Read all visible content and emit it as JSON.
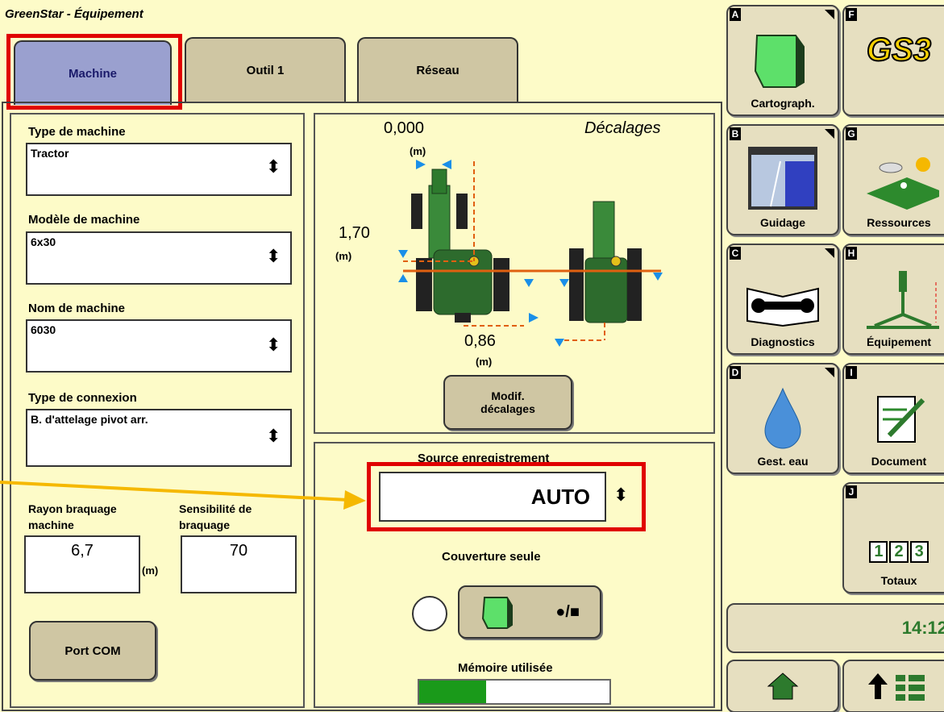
{
  "window_title": "GreenStar - Équipement",
  "tabs": [
    {
      "label": "Machine"
    },
    {
      "label": "Outil 1"
    },
    {
      "label": "Réseau"
    }
  ],
  "machine": {
    "type_label": "Type de machine",
    "type_value": "Tractor",
    "model_label": "Modèle de machine",
    "model_value": "6x30",
    "name_label": "Nom de machine",
    "name_value": "6030",
    "connection_label": "Type de connexion",
    "connection_value": "B. d'attelage pivot arr.",
    "turn_radius_label_1": "Rayon braquage",
    "turn_radius_label_2": "machine",
    "turn_radius_value": "6,7",
    "turn_radius_unit": "(m)",
    "sensitivity_label_1": "Sensibilité de",
    "sensitivity_label_2": "braquage",
    "sensitivity_value": "70",
    "com_port_label": "Port COM"
  },
  "offsets": {
    "title": "Décalages",
    "top_value": "0,000",
    "top_unit": "(m)",
    "left_value": "1,70",
    "left_unit": "(m)",
    "bottom_value": "0,86",
    "bottom_unit": "(m)",
    "modify_label_1": "Modif.",
    "modify_label_2": "décalages"
  },
  "recording": {
    "source_label": "Source enregistrement",
    "source_value": "AUTO",
    "coverage_label": "Couverture seule",
    "record_symbol": "●/■",
    "memory_label": "Mémoire utilisée",
    "memory_used_fraction": 0.35
  },
  "side_buttons": [
    {
      "letter": "A",
      "label": "Cartograph."
    },
    {
      "letter": "F",
      "label": "GS3"
    },
    {
      "letter": "B",
      "label": "Guidage"
    },
    {
      "letter": "G",
      "label": "Ressources"
    },
    {
      "letter": "C",
      "label": "Diagnostics"
    },
    {
      "letter": "H",
      "label": "Équipement"
    },
    {
      "letter": "D",
      "label": "Gest. eau"
    },
    {
      "letter": "I",
      "label": "Document"
    },
    {
      "letter": "J",
      "label": "Totaux"
    }
  ],
  "totals_digits": [
    "1",
    "2",
    "3"
  ],
  "clock": "14:12",
  "colors": {
    "background": "#fdfbc8",
    "button": "#cfc6a3",
    "active_tab": "#9aa0cf",
    "highlight": "#e00000",
    "tractor_green": "#2d7a2d",
    "arrow": "#f5b800"
  }
}
